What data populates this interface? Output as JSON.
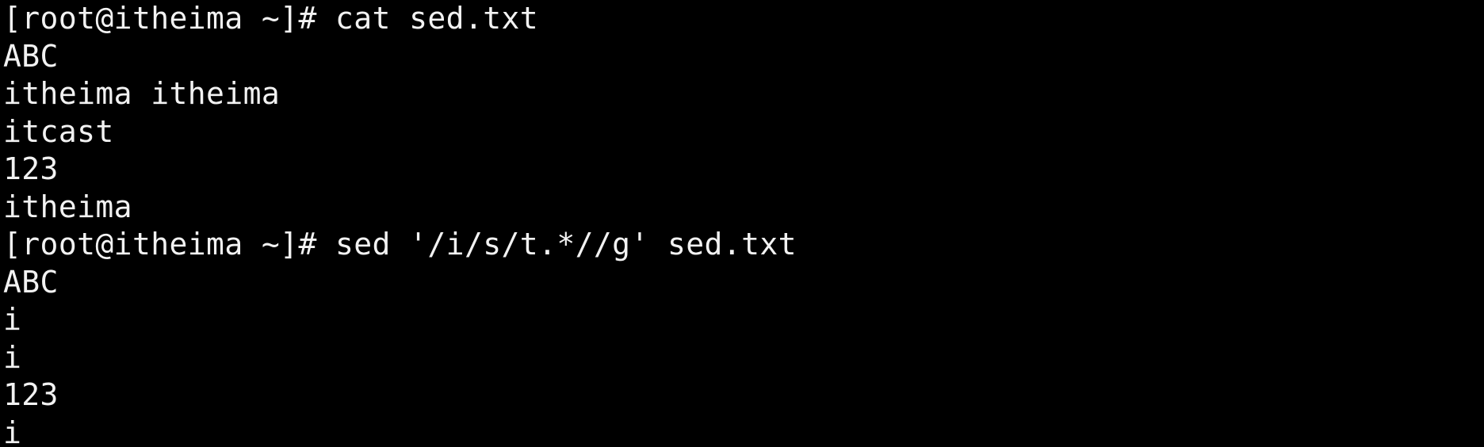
{
  "terminal": {
    "lines": [
      "[root@itheima ~]# cat sed.txt",
      "ABC",
      "itheima itheima",
      "itcast",
      "123",
      "itheima",
      "[root@itheima ~]# sed '/i/s/t.*//g' sed.txt",
      "ABC",
      "i",
      "i",
      "123",
      "i"
    ],
    "colors": {
      "background": "#000000",
      "foreground": "#f2f2f2"
    }
  }
}
